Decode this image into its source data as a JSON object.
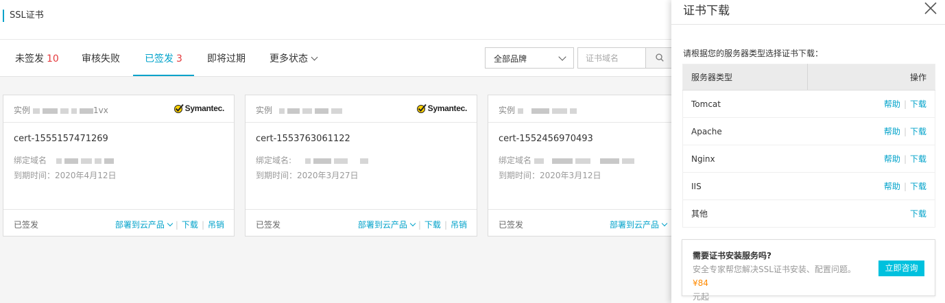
{
  "header": {
    "title": "SSL证书"
  },
  "tabs": [
    {
      "label": "未签发",
      "count": "10"
    },
    {
      "label": "审核失败",
      "count": ""
    },
    {
      "label": "已签发",
      "count": "3"
    },
    {
      "label": "即将过期",
      "count": ""
    },
    {
      "label": "更多状态",
      "count": ""
    }
  ],
  "filters": {
    "brand_selected": "全部品牌",
    "domain_placeholder": "证书域名",
    "search_icon": "search-icon"
  },
  "cards": [
    {
      "instance_label": "实例",
      "instance_suffix": "1vx",
      "brand": "Symantec.",
      "cert_name": "cert-1555157471269",
      "domain_label": "绑定域名",
      "expiry_label": "到期时间：",
      "expiry": "2020年4月12日",
      "status": "已签发",
      "actions": [
        "部署到云产品",
        "下载",
        "吊销"
      ]
    },
    {
      "instance_label": "实例",
      "instance_suffix": "",
      "brand": "Symantec.",
      "cert_name": "cert-1553763061122",
      "domain_label": "绑定域名:",
      "expiry_label": "到期时间：",
      "expiry": "2020年3月27日",
      "status": "已签发",
      "actions": [
        "部署到云产品",
        "下载",
        "吊销"
      ]
    },
    {
      "instance_label": "实例",
      "instance_suffix": "",
      "brand": "",
      "cert_name": "cert-1552456970493",
      "domain_label": "绑定域名",
      "expiry_label": "到期时间：",
      "expiry": "2020年3月12日",
      "status": "已签发",
      "actions": [
        "部署到云产品"
      ]
    }
  ],
  "drawer": {
    "title": "证书下载",
    "close_icon": "close-icon",
    "instruction": "请根据您的服务器类型选择证书下载：",
    "col_type": "服务器类型",
    "col_action": "操作",
    "rows": [
      {
        "type": "Tomcat",
        "help": "帮助",
        "download": "下载"
      },
      {
        "type": "Apache",
        "help": "帮助",
        "download": "下载"
      },
      {
        "type": "Nginx",
        "help": "帮助",
        "download": "下载"
      },
      {
        "type": "IIS",
        "help": "帮助",
        "download": "下载"
      },
      {
        "type": "其他",
        "help": "",
        "download": "下载"
      }
    ],
    "service": {
      "title": "需要证书安装服务吗?",
      "desc": "安全专家帮您解决SSL证书安装、配置问题。",
      "price": "¥84",
      "unit": "元起",
      "button": "立即咨询"
    }
  },
  "colors": {
    "accent": "#00a2ca",
    "count_red": "#e4393c",
    "price_orange": "#ff8a00",
    "button_cyan": "#00c1de"
  }
}
